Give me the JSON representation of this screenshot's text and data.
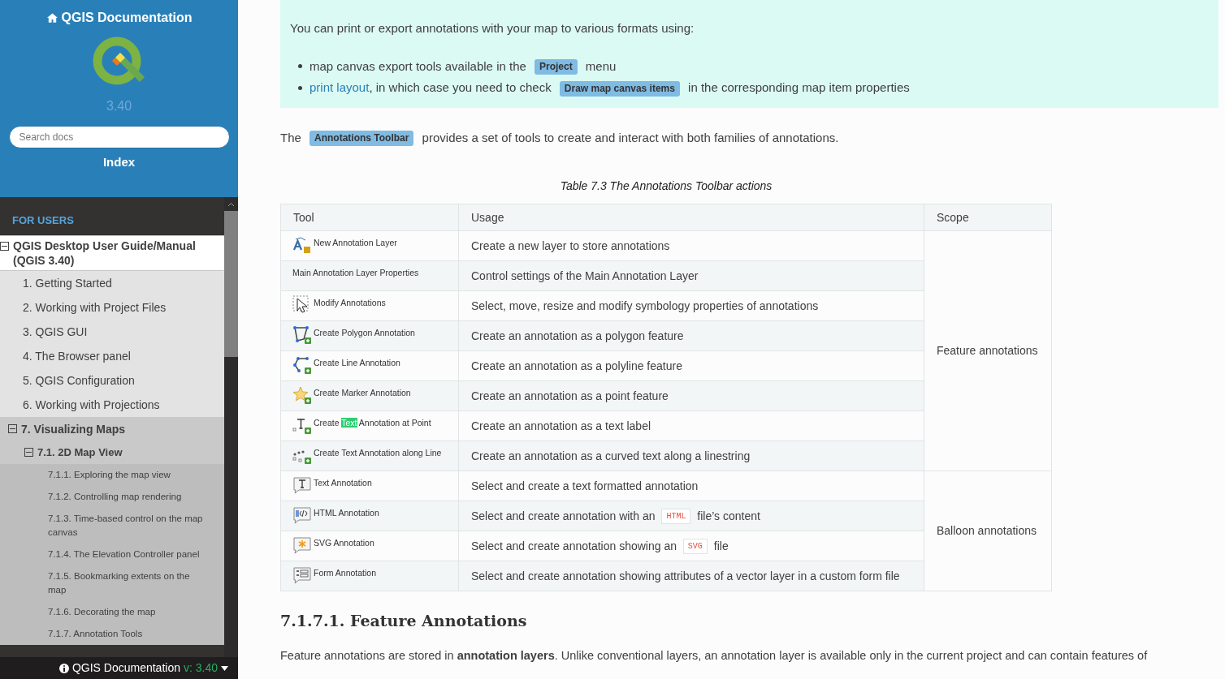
{
  "sidebar": {
    "title": "QGIS Documentation",
    "version": "3.40",
    "search": {
      "placeholder": "Search docs"
    },
    "index_link": "Index",
    "nav": {
      "caption": "FOR USERS",
      "items": [
        {
          "label": "QGIS Desktop User Guide/Manual (QGIS 3.40)",
          "expanded": true,
          "children": [
            {
              "label": "1. Getting Started"
            },
            {
              "label": "2. Working with Project Files"
            },
            {
              "label": "3. QGIS GUI"
            },
            {
              "label": "4. The Browser panel"
            },
            {
              "label": "5. QGIS Configuration"
            },
            {
              "label": "6. Working with Projections"
            },
            {
              "label": "7. Visualizing Maps",
              "expanded": true,
              "children": [
                {
                  "label": "7.1. 2D Map View",
                  "expanded": true,
                  "children": [
                    {
                      "label": "7.1.1. Exploring the map view"
                    },
                    {
                      "label": "7.1.2. Controlling map rendering"
                    },
                    {
                      "label": "7.1.3. Time-based control on the map canvas"
                    },
                    {
                      "label": "7.1.4. The Elevation Controller panel"
                    },
                    {
                      "label": "7.1.5. Bookmarking extents on the map"
                    },
                    {
                      "label": "7.1.6. Decorating the map"
                    },
                    {
                      "label": "7.1.7. Annotation Tools"
                    }
                  ]
                }
              ]
            }
          ]
        }
      ]
    },
    "footer": {
      "label": "QGIS Documentation",
      "version": "v: 3.40"
    }
  },
  "note": {
    "text": "You can print or export annotations with your map to various formats using:",
    "bullets": [
      [
        {
          "kind": "text",
          "text": "map canvas export tools available in the "
        },
        {
          "kind": "gui",
          "text": "Project"
        },
        {
          "kind": "text",
          "text": " menu"
        }
      ],
      [
        {
          "kind": "link",
          "text": "print layout"
        },
        {
          "kind": "text",
          "text": ", in which case you need to check "
        },
        {
          "kind": "gui",
          "text": "Draw map canvas items"
        },
        {
          "kind": "text",
          "text": " in the corresponding map item properties"
        }
      ]
    ]
  },
  "intro": [
    {
      "kind": "text",
      "text": "The "
    },
    {
      "kind": "gui",
      "text": "Annotations Toolbar"
    },
    {
      "kind": "text",
      "text": " provides a set of tools to create and interact with both families of annotations."
    }
  ],
  "table": {
    "caption": "Table 7.3 The Annotations Toolbar actions",
    "columns": [
      "Tool",
      "Usage",
      "Scope"
    ],
    "groups": [
      {
        "scope": "Feature annotations",
        "rows": [
          {
            "kind": "layer",
            "tool": [
              {
                "text": "New Annotation Layer",
                "highlighted": false
              }
            ],
            "usage": [
              {
                "kind": "text",
                "text": "Create a new layer to store annotations"
              }
            ]
          },
          {
            "kind": "none",
            "tool": [
              {
                "text": "Main Annotation Layer Properties",
                "highlighted": false
              }
            ],
            "usage": [
              {
                "kind": "text",
                "text": "Control settings of the Main Annotation Layer"
              }
            ]
          },
          {
            "kind": "cursor",
            "tool": [
              {
                "text": "Modify Annotations",
                "highlighted": false
              }
            ],
            "usage": [
              {
                "kind": "text",
                "text": "Select, move, resize and modify symbology properties of annotations"
              }
            ]
          },
          {
            "kind": "polygon",
            "tool": [
              {
                "text": "Create Polygon Annotation",
                "highlighted": false
              }
            ],
            "usage": [
              {
                "kind": "text",
                "text": "Create an annotation as a polygon feature"
              }
            ]
          },
          {
            "kind": "line",
            "tool": [
              {
                "text": "Create Line Annotation",
                "highlighted": false
              }
            ],
            "usage": [
              {
                "kind": "text",
                "text": "Create an annotation as a polyline feature"
              }
            ]
          },
          {
            "kind": "star",
            "tool": [
              {
                "text": "Create Marker Annotation",
                "highlighted": false
              }
            ],
            "usage": [
              {
                "kind": "text",
                "text": "Create an annotation as a point feature"
              }
            ]
          },
          {
            "kind": "text-point",
            "tool": [
              {
                "text": "Create ",
                "highlighted": false
              },
              {
                "text": "Text",
                "highlighted": true
              },
              {
                "text": " Annotation at Point",
                "highlighted": false
              }
            ],
            "usage": [
              {
                "kind": "text",
                "text": "Create an annotation as a text label"
              }
            ]
          },
          {
            "kind": "text-line",
            "tool": [
              {
                "text": "Create Text Annotation along Line",
                "highlighted": false
              }
            ],
            "usage": [
              {
                "kind": "text",
                "text": "Create an annotation as a curved text along a linestring"
              }
            ]
          }
        ]
      },
      {
        "scope": "Balloon annotations",
        "rows": [
          {
            "kind": "callout-text",
            "tool": [
              {
                "text": "Text Annotation",
                "highlighted": false
              }
            ],
            "usage": [
              {
                "kind": "text",
                "text": "Select and create a text formatted annotation"
              }
            ]
          },
          {
            "kind": "callout-html",
            "tool": [
              {
                "text": "HTML Annotation",
                "highlighted": false
              }
            ],
            "usage": [
              {
                "kind": "text",
                "text": "Select and create annotation with an "
              },
              {
                "kind": "code",
                "text": "HTML"
              },
              {
                "kind": "text",
                "text": " file’s content"
              }
            ]
          },
          {
            "kind": "callout-svg",
            "tool": [
              {
                "text": "SVG Annotation",
                "highlighted": false
              }
            ],
            "usage": [
              {
                "kind": "text",
                "text": "Select and create annotation showing an "
              },
              {
                "kind": "code",
                "text": "SVG"
              },
              {
                "kind": "text",
                "text": " file"
              }
            ]
          },
          {
            "kind": "callout-form",
            "tool": [
              {
                "text": "Form Annotation",
                "highlighted": false
              }
            ],
            "usage": [
              {
                "kind": "text",
                "text": "Select and create annotation showing attributes of a vector layer in a custom form file"
              }
            ]
          }
        ]
      }
    ]
  },
  "section": {
    "heading": "7.1.7.1. Feature Annotations",
    "paragraph": "Feature annotations are stored in **annotation layers**. Unlike conventional layers, an annotation layer is available only in the current project and can contain features of"
  }
}
